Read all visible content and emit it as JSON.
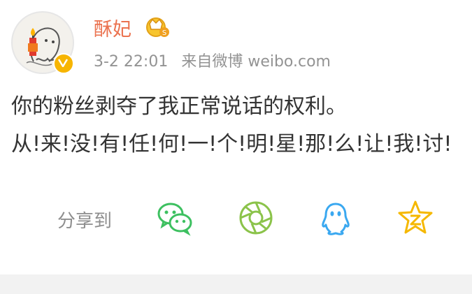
{
  "post": {
    "user_name": "酥妃",
    "time": "3-2 22:01",
    "source": "来自微博 weibo.com",
    "content_lines": [
      "你的粉丝剥夺了我正常说话的权利。",
      "从!来!没!有!任!何!一!个!明!星!那!么!让!我!讨!"
    ]
  },
  "share": {
    "label": "分享到",
    "targets": [
      "wechat-icon",
      "moments-icon",
      "qq-icon",
      "qzone-icon"
    ]
  },
  "colors": {
    "name": "#eb7350",
    "meta": "#939393",
    "text": "#333333",
    "wechat": "#3dc060",
    "moments": "#8bc34a",
    "qq": "#3aa8f0",
    "qzone": "#f5b800"
  }
}
